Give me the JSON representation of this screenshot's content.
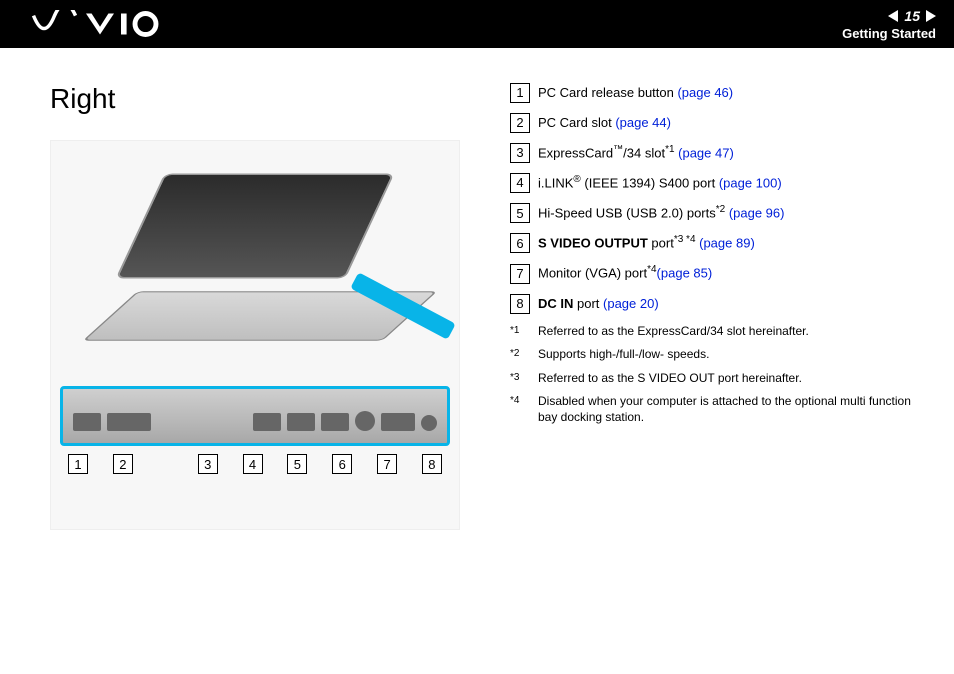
{
  "header": {
    "page_number": "15",
    "section": "Getting Started"
  },
  "title": "Right",
  "items": [
    {
      "num": "1",
      "text": "PC Card release button ",
      "ref": "(page 46)"
    },
    {
      "num": "2",
      "text": "PC Card slot ",
      "ref": "(page 44)"
    },
    {
      "num": "3",
      "pre": "ExpressCard",
      "sup1": "™",
      "mid": "/34 slot",
      "sup2": "*1",
      "post": " ",
      "ref": "(page 47)"
    },
    {
      "num": "4",
      "pre": "i.LINK",
      "sup1": "®",
      "mid": " (IEEE 1394) S400 port ",
      "ref": "(page 100)"
    },
    {
      "num": "5",
      "pre": "Hi-Speed USB (USB 2.0) ports",
      "sup1": "*2",
      "post": " ",
      "ref": "(page 96)"
    },
    {
      "num": "6",
      "boldpre": "S VIDEO OUTPUT",
      "mid": " port",
      "sup1": "*3 ",
      "sup2": "*4",
      "post": " ",
      "ref": "(page 89)"
    },
    {
      "num": "7",
      "pre": "Monitor (VGA) port",
      "sup1": "*4",
      "ref": "(page 85)"
    },
    {
      "num": "8",
      "boldpre": "DC IN",
      "mid": " port ",
      "ref": "(page 20)"
    }
  ],
  "footnotes": [
    {
      "mark": "*1",
      "text": "Referred to as the ExpressCard/34 slot hereinafter."
    },
    {
      "mark": "*2",
      "text": "Supports high-/full-/low- speeds."
    },
    {
      "mark": "*3",
      "text": "Referred to as the S VIDEO OUT port hereinafter."
    },
    {
      "mark": "*4",
      "text": "Disabled when your computer is attached to the optional multi function bay docking station."
    }
  ],
  "callouts": [
    "1",
    "2",
    "3",
    "4",
    "5",
    "6",
    "7",
    "8"
  ]
}
